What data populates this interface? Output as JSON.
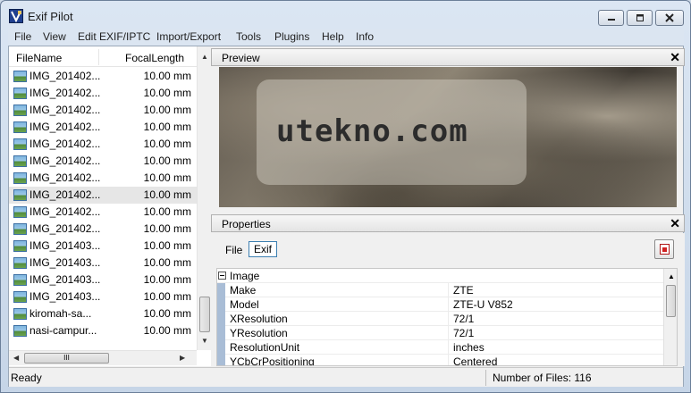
{
  "window": {
    "title": "Exif Pilot",
    "icons": [
      "app-icon",
      "minimize-icon",
      "maximize-icon",
      "close-icon"
    ]
  },
  "menu": [
    "File",
    "View",
    "Edit EXIF/IPTC",
    "Import/Export",
    "Tools",
    "Plugins",
    "Help",
    "Info"
  ],
  "filelist": {
    "columns": [
      "FileName",
      "FocalLength"
    ],
    "rows": [
      {
        "name": "IMG_201402...",
        "focal": "10.00 mm"
      },
      {
        "name": "IMG_201402...",
        "focal": "10.00 mm"
      },
      {
        "name": "IMG_201402...",
        "focal": "10.00 mm"
      },
      {
        "name": "IMG_201402...",
        "focal": "10.00 mm"
      },
      {
        "name": "IMG_201402...",
        "focal": "10.00 mm"
      },
      {
        "name": "IMG_201402...",
        "focal": "10.00 mm"
      },
      {
        "name": "IMG_201402...",
        "focal": "10.00 mm"
      },
      {
        "name": "IMG_201402...",
        "focal": "10.00 mm"
      },
      {
        "name": "IMG_201402...",
        "focal": "10.00 mm"
      },
      {
        "name": "IMG_201402...",
        "focal": "10.00 mm"
      },
      {
        "name": "IMG_201403...",
        "focal": "10.00 mm"
      },
      {
        "name": "IMG_201403...",
        "focal": "10.00 mm"
      },
      {
        "name": "IMG_201403...",
        "focal": "10.00 mm"
      },
      {
        "name": "IMG_201403...",
        "focal": "10.00 mm"
      },
      {
        "name": "kiromah-sa...",
        "focal": "10.00 mm"
      },
      {
        "name": "nasi-campur...",
        "focal": "10.00 mm"
      }
    ],
    "selected_index": 7,
    "hscroll_grip": "III"
  },
  "preview": {
    "title": "Preview",
    "watermark": "utekno.com"
  },
  "properties": {
    "title": "Properties",
    "file_label": "File",
    "tab": "Exif",
    "group": "Image",
    "rows": [
      {
        "name": "Make",
        "value": "ZTE"
      },
      {
        "name": "Model",
        "value": "ZTE-U V852"
      },
      {
        "name": "XResolution",
        "value": "72/1"
      },
      {
        "name": "YResolution",
        "value": "72/1"
      },
      {
        "name": "ResolutionUnit",
        "value": "inches"
      },
      {
        "name": "YCbCrPositioning",
        "value": "Centered"
      }
    ]
  },
  "status": {
    "left": "Ready",
    "right": "Number of Files: 116"
  },
  "colors": {
    "titlebar": "#dbe6f3",
    "selection": "#e6e6e6",
    "grid_gutter": "#a9bdd6",
    "tab_border": "#3c7fb1"
  }
}
